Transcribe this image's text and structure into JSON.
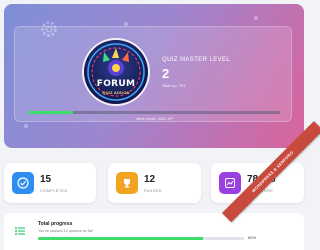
{
  "hero": {
    "avatar_badge": "FORUM",
    "avatar_badge_sub": "QUIZ ADDON",
    "level_label": "QUIZ MASTER LEVEL",
    "level_value": "2",
    "total_xp": "Total Xp: 751",
    "xp_progress": 0.18,
    "next_level": "Next Level: 3501 XP"
  },
  "stats": [
    {
      "value": "15",
      "label": "COMPLETED",
      "icon": "check-circle-icon",
      "color": "#2e8ef0"
    },
    {
      "value": "12",
      "label": "PASSED",
      "icon": "trophy-icon",
      "color": "#f0a422"
    },
    {
      "value": "78.8%",
      "label": "AVG SCORE",
      "icon": "chart-icon",
      "color": "#9b40e0"
    }
  ],
  "progress": {
    "title": "Total progress",
    "subtitle": "You've passed 12 quizzes so far!",
    "value": 0.8,
    "percent_label": "80%"
  },
  "ribbon": {
    "text": "WORDPRESS & XENFORO"
  },
  "colors": {
    "progress_green": "#3ddc6a",
    "ribbon_red": "#c84a3d"
  }
}
